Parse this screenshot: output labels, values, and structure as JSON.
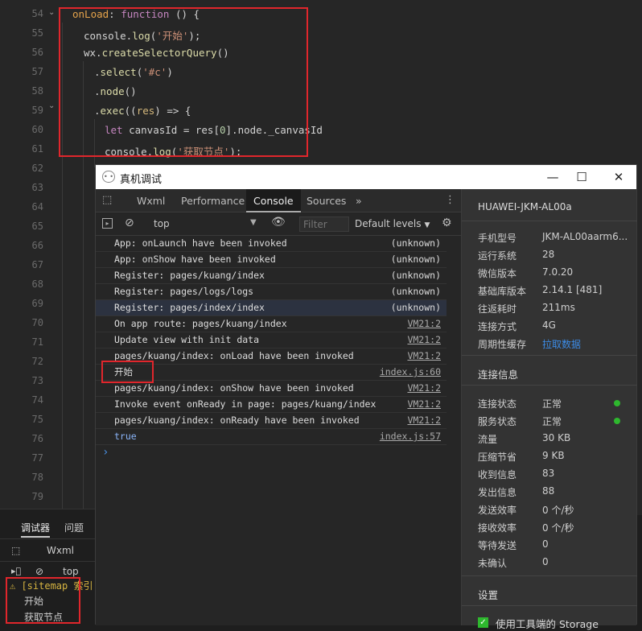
{
  "editor": {
    "line_numbers": [
      "54",
      "55",
      "56",
      "57",
      "58",
      "59",
      "60",
      "61",
      "62",
      "63",
      "64",
      "65",
      "66",
      "67",
      "68",
      "69",
      "70",
      "71",
      "72",
      "73",
      "74",
      "75",
      "76",
      "77",
      "78",
      "79"
    ],
    "code": {
      "l54a": "onLoad",
      "l54b": ": ",
      "l54c": "function",
      "l54d": " () {",
      "l55a": "console.",
      "l55b": "log",
      "l55c": "(",
      "l55d": "'开始'",
      "l55e": ");",
      "l56a": "wx.",
      "l56b": "createSelectorQuery",
      "l56c": "()",
      "l57a": ".",
      "l57b": "select",
      "l57c": "(",
      "l57d": "'#c'",
      "l57e": ")",
      "l58a": ".",
      "l58b": "node",
      "l58c": "()",
      "l59a": ".",
      "l59b": "exec",
      "l59c": "((",
      "l59d": "res",
      "l59e": ") => {",
      "l60a": "let",
      "l60b": " canvasId = res[",
      "l60c": "0",
      "l60d": "].node._canvasId",
      "l61a": "console.",
      "l61b": "log",
      "l61c": "(",
      "l61d": "'获取节点'",
      "l61e": ");"
    }
  },
  "bottom_panel": {
    "tab_debugger": "调试器",
    "tab_issues": "问题",
    "tab_wxml": "Wxml",
    "top_label": "top",
    "sitemap_text": "[sitemap 索引",
    "log1": "开始",
    "log2": "获取节点"
  },
  "devtools": {
    "title": "真机调试",
    "tabs": [
      "Wxml",
      "Performance",
      "Console",
      "Sources"
    ],
    "more_tabs": "»",
    "context": "top",
    "filter_placeholder": "Filter",
    "levels": "Default levels",
    "console_rows": [
      {
        "msg": "App: onLaunch have been invoked",
        "src": "(unknown)"
      },
      {
        "msg": "App: onShow have been invoked",
        "src": "(unknown)"
      },
      {
        "msg": "Register: pages/kuang/index",
        "src": "(unknown)"
      },
      {
        "msg": "Register: pages/logs/logs",
        "src": "(unknown)"
      },
      {
        "msg": "Register: pages/index/index",
        "src": "(unknown)"
      },
      {
        "msg": "On app route: pages/kuang/index",
        "src": "VM21:2"
      },
      {
        "msg": "Update view with init data",
        "src": "VM21:2"
      },
      {
        "msg": "pages/kuang/index: onLoad have been invoked",
        "src": "VM21:2"
      },
      {
        "msg": "开始",
        "src": "index.js:60"
      },
      {
        "msg": "pages/kuang/index: onShow have been invoked",
        "src": "VM21:2"
      },
      {
        "msg": "Invoke event onReady in page: pages/kuang/index",
        "src": "VM21:2"
      },
      {
        "msg": "pages/kuang/index: onReady have been invoked",
        "src": "VM21:2"
      },
      {
        "msg": "true",
        "src": "index.js:57"
      }
    ],
    "prompt": "›"
  },
  "side_panel": {
    "device": "HUAWEI-JKM-AL00a",
    "info": [
      {
        "k": "手机型号",
        "v": "JKM-AL00aarm6..."
      },
      {
        "k": "运行系统",
        "v": "28"
      },
      {
        "k": "微信版本",
        "v": "7.0.20"
      },
      {
        "k": "基础库版本",
        "v": "2.14.1 [481]"
      },
      {
        "k": "往返耗时",
        "v": "211ms"
      },
      {
        "k": "连接方式",
        "v": "4G"
      },
      {
        "k": "周期性缓存",
        "v": "拉取数据"
      }
    ],
    "conn_title": "连接信息",
    "conn": [
      {
        "k": "连接状态",
        "v": "正常"
      },
      {
        "k": "服务状态",
        "v": "正常"
      },
      {
        "k": "流量",
        "v": "30 KB"
      },
      {
        "k": "压缩节省",
        "v": "9 KB"
      },
      {
        "k": "收到信息",
        "v": "83"
      },
      {
        "k": "发出信息",
        "v": "88"
      },
      {
        "k": "发送效率",
        "v": "0 个/秒"
      },
      {
        "k": "接收效率",
        "v": "0 个/秒"
      },
      {
        "k": "等待发送",
        "v": "0"
      },
      {
        "k": "未确认",
        "v": "0"
      }
    ],
    "settings_title": "设置",
    "storage_label": "使用工具端的 Storage"
  },
  "colors": {
    "accent_red": "#e0262c",
    "status_green": "#2eb82e",
    "link_blue": "#3c8ce7"
  }
}
